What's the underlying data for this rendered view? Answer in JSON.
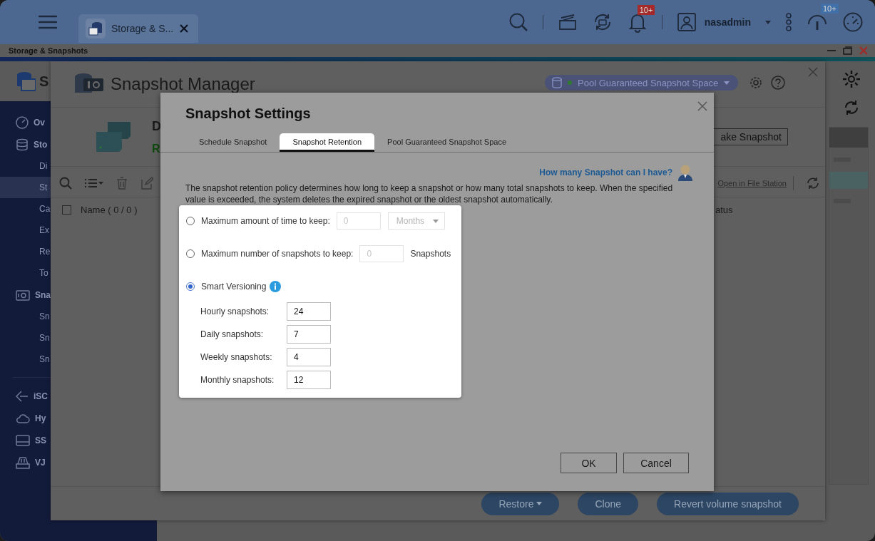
{
  "top_bar": {
    "tab": {
      "label": "Storage & S..."
    },
    "notification_badge": "10+",
    "user": "nasadmin",
    "status_badge": "10+"
  },
  "app_window": {
    "title": "Storage & Snapshots",
    "header_title": "S",
    "sidebar": {
      "items": [
        {
          "label": "Ov",
          "selected": false
        },
        {
          "label": "Sto",
          "selected": false,
          "children": [
            {
              "label": "Di",
              "selected": false
            },
            {
              "label": "St",
              "selected": true
            },
            {
              "label": "Ca",
              "selected": false
            },
            {
              "label": "Ex",
              "selected": false
            },
            {
              "label": "Re",
              "selected": false
            },
            {
              "label": "To",
              "selected": false
            }
          ]
        },
        {
          "label": "Sna",
          "selected": false,
          "children": [
            {
              "label": "Sn",
              "selected": false
            },
            {
              "label": "Sn",
              "selected": false
            },
            {
              "label": "Sn",
              "selected": false
            }
          ]
        },
        {
          "label": "iSC",
          "selected": false
        },
        {
          "label": "Hy",
          "selected": false
        },
        {
          "label": "SS",
          "selected": false
        },
        {
          "label": "VJ",
          "selected": false
        }
      ]
    }
  },
  "snapshot_manager": {
    "title": "Snapshot Manager",
    "space_selector": "Pool Guaranteed Snapshot Space",
    "volume": {
      "name": "D",
      "status": "R"
    },
    "take_snapshot_button": "ake Snapshot",
    "file_station_link": "Open in File Station",
    "select_all_checked": false,
    "columns": [
      "Name ( 0 / 0 )",
      "atus"
    ],
    "buttons": [
      {
        "label": "Restore",
        "dropdown": true
      },
      {
        "label": "Clone",
        "dropdown": false
      },
      {
        "label": "Revert volume snapshot",
        "dropdown": false
      }
    ]
  },
  "settings_dialog": {
    "title": "Snapshot Settings",
    "tabs": [
      {
        "label": "Schedule Snapshot",
        "selected": false
      },
      {
        "label": "Snapshot Retention",
        "selected": true
      },
      {
        "label": "Pool Guaranteed Snapshot Space",
        "selected": false
      }
    ],
    "help_link": "How many Snapshot can I have?",
    "description": "The snapshot retention policy determines how long to keep a snapshot or how many total snapshots to keep. When the specified value is exceeded, the system deletes the expired snapshot or the oldest snapshot automatically.",
    "options": [
      {
        "kind": "time",
        "label": "Maximum amount of time to keep:",
        "selected": false,
        "placeholder": "0",
        "unit": "Months",
        "disabled": true
      },
      {
        "kind": "count",
        "label": "Maximum number of snapshots to keep:",
        "selected": false,
        "placeholder": "0",
        "suffix": "Snapshots",
        "disabled": true
      },
      {
        "kind": "smart",
        "label": "Smart Versioning",
        "selected": true,
        "fields": [
          {
            "label": "Hourly snapshots:",
            "value": "24"
          },
          {
            "label": "Daily snapshots:",
            "value": "7"
          },
          {
            "label": "Weekly snapshots:",
            "value": "4"
          },
          {
            "label": "Monthly snapshots:",
            "value": "12"
          }
        ]
      }
    ],
    "buttons": [
      "OK",
      "Cancel"
    ]
  }
}
